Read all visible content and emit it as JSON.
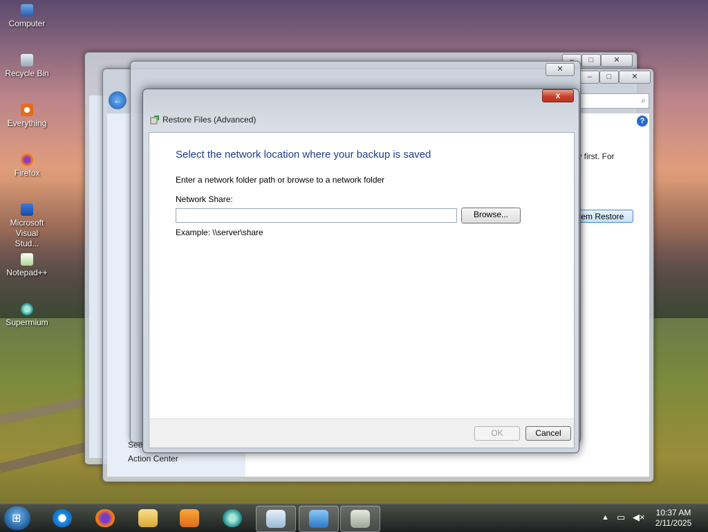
{
  "desktop": {
    "icons": [
      {
        "label": "Computer"
      },
      {
        "label": "Recycle Bin"
      },
      {
        "label": "Everything"
      },
      {
        "label": "Firefox"
      },
      {
        "label": "Microsoft Visual Stud..."
      },
      {
        "label": "Notepad++"
      },
      {
        "label": "Supermium"
      }
    ]
  },
  "background_windows": {
    "partial_text": "try first. For",
    "restore_button": "tem Restore",
    "sidebar_link": "Action Center",
    "sidebar_link_partial": "See"
  },
  "dialog": {
    "title": "Restore Files (Advanced)",
    "close_label": "x",
    "heading": "Select the network location where your backup is saved",
    "instruction": "Enter a network folder path or browse to a network folder",
    "share_label": "Network Share:",
    "share_value": "",
    "browse_label": "Browse...",
    "example": "Example: \\\\server\\share",
    "ok_label": "OK",
    "cancel_label": "Cancel"
  },
  "taskbar": {
    "time": "10:37 AM",
    "date": "2/11/2025"
  },
  "colors": {
    "heading": "#1e3a8c",
    "close_button": "#c7412c"
  }
}
